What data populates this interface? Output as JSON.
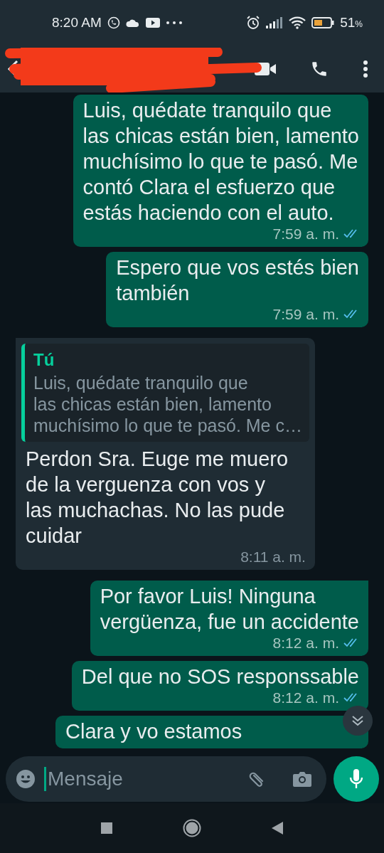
{
  "status_bar": {
    "time": "8:20 AM",
    "battery_text": "51",
    "battery_unit": "%"
  },
  "header": {
    "redacted": true
  },
  "messages": [
    {
      "kind": "out",
      "tail": false,
      "lines": [
        "Luis, quédate tranquilo que",
        "las chicas están bien, lamento",
        "muchísimo lo que te pasó. Me",
        "contó Clara el esfuerzo que",
        "estás haciendo con el auto."
      ],
      "time": "7:59 a. m.",
      "read": true
    },
    {
      "kind": "out",
      "tail": false,
      "lines": [
        "Espero que vos estés bien",
        "también"
      ],
      "time": "7:59 a. m.",
      "read": true
    },
    {
      "kind": "in",
      "tail": true,
      "quote": {
        "author": "Tú",
        "lines": [
          "Luis, quédate tranquilo que",
          "las chicas están bien, lamento",
          "muchísimo lo que te pasó. Me c…"
        ]
      },
      "lines": [
        "Perdon Sra. Euge me muero",
        "de la verguenza con vos y",
        "las muchachas. No las pude",
        "cuidar"
      ],
      "time": "8:11 a. m."
    },
    {
      "kind": "out",
      "tail": true,
      "lines": [
        "Por favor Luis! Ninguna",
        "vergüenza, fue un accidente"
      ],
      "time": "8:12 a. m.",
      "read": true
    },
    {
      "kind": "out",
      "tail": false,
      "lines": [
        "Del que no SOS responssable"
      ],
      "time": "8:12 a. m.",
      "read": true
    },
    {
      "kind": "out",
      "tail": false,
      "lines": [
        "Clara y vo estamos"
      ]
    }
  ],
  "composer": {
    "placeholder": "Mensaje"
  }
}
